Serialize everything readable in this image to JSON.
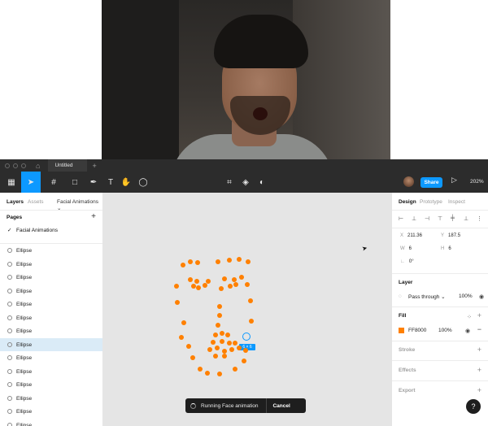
{
  "window": {
    "tab_title": "Untitled"
  },
  "toolbar": {
    "share_label": "Share",
    "zoom_label": "202%"
  },
  "left_panel": {
    "tabs": {
      "layers": "Layers",
      "assets": "Assets",
      "page_selector": "Facial Animations ⌄"
    },
    "pages_label": "Pages",
    "pages": [
      {
        "name": "Facial Animations",
        "checked": true
      }
    ],
    "layers": [
      {
        "name": "Ellipse"
      },
      {
        "name": "Ellipse"
      },
      {
        "name": "Ellipse"
      },
      {
        "name": "Ellipse"
      },
      {
        "name": "Ellipse"
      },
      {
        "name": "Ellipse"
      },
      {
        "name": "Ellipse"
      },
      {
        "name": "Ellipse",
        "selected": true
      },
      {
        "name": "Ellipse"
      },
      {
        "name": "Ellipse"
      },
      {
        "name": "Ellipse"
      },
      {
        "name": "Ellipse"
      },
      {
        "name": "Ellipse"
      },
      {
        "name": "Ellipse"
      }
    ]
  },
  "canvas": {
    "dot_color": "#FF8000",
    "selection_label": "6 × 6",
    "toast": {
      "message": "Running Face animation",
      "cancel": "Cancel"
    }
  },
  "right_panel": {
    "tabs": {
      "design": "Design",
      "prototype": "Prototype",
      "inspect": "Inspect"
    },
    "x": {
      "label": "X",
      "value": "211.36"
    },
    "y": {
      "label": "Y",
      "value": "187.5"
    },
    "w": {
      "label": "W",
      "value": "6"
    },
    "h": {
      "label": "H",
      "value": "6"
    },
    "rotation": {
      "label": "∟",
      "value": "0°"
    },
    "layer": {
      "title": "Layer",
      "blend": "Pass through ⌄",
      "opacity": "100%"
    },
    "fill": {
      "title": "Fill",
      "hex": "FF8000",
      "opacity": "100%",
      "color": "#FF8000"
    },
    "stroke_title": "Stroke",
    "effects_title": "Effects",
    "export_title": "Export",
    "help": "?"
  }
}
